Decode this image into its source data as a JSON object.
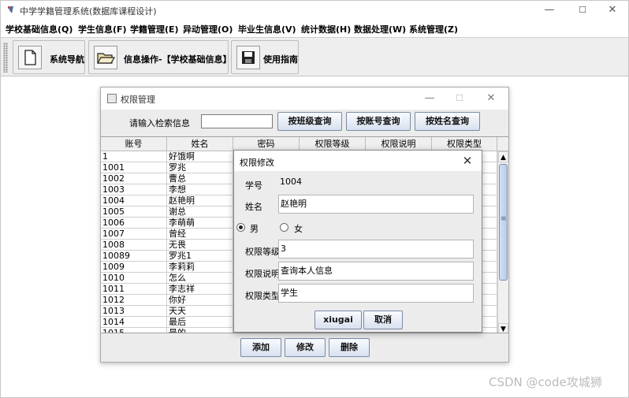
{
  "main_window": {
    "title": "中学学籍管理系统(数据库课程设计)",
    "controls": {
      "minimize": "—",
      "maximize": "☐",
      "close": "✕"
    }
  },
  "menubar": {
    "items": [
      {
        "label": "学校基础信息(Q)"
      },
      {
        "label": "学生信息(F)"
      },
      {
        "label": "学籍管理(E)"
      },
      {
        "label": "异动管理(O)"
      },
      {
        "label": "毕业生信息(V)"
      },
      {
        "label": "统计数据(H)"
      },
      {
        "label": "数据处理(W)"
      },
      {
        "label": "系统管理(Z)"
      }
    ]
  },
  "toolbar": {
    "buttons": [
      {
        "label": "系统导航",
        "icon": "document-icon"
      },
      {
        "label": "信息操作-【学校基础信息】",
        "icon": "folder-open-icon"
      },
      {
        "label": "使用指南",
        "icon": "floppy-disk-icon"
      }
    ]
  },
  "perm_window": {
    "title": "权限管理",
    "search_label": "请输入检索信息",
    "search_value": "",
    "buttons": {
      "by_class": "按班级查询",
      "by_account": "按账号查询",
      "by_name": "按姓名查询"
    },
    "columns": [
      "账号",
      "姓名",
      "密码",
      "权限等级",
      "权限说明",
      "权限类型"
    ],
    "rows": [
      [
        "1",
        "好饿啊",
        "",
        "",
        "",
        ""
      ],
      [
        "1001",
        "罗兆",
        "",
        "",
        "",
        ""
      ],
      [
        "1002",
        "曹总",
        "",
        "",
        "",
        ""
      ],
      [
        "1003",
        "李想",
        "",
        "",
        "",
        ""
      ],
      [
        "1004",
        "赵艳明",
        "",
        "",
        "",
        ""
      ],
      [
        "1005",
        "谢总",
        "",
        "",
        "",
        ""
      ],
      [
        "1006",
        "李萌萌",
        "",
        "",
        "",
        ""
      ],
      [
        "1007",
        "曾经",
        "",
        "",
        "",
        ""
      ],
      [
        "1008",
        "无畏",
        "",
        "",
        "",
        ""
      ],
      [
        "10089",
        "罗兆1",
        "",
        "",
        "",
        ""
      ],
      [
        "1009",
        "李莉莉",
        "",
        "",
        "",
        ""
      ],
      [
        "1010",
        "怎么",
        "",
        "",
        "",
        ""
      ],
      [
        "1011",
        "李志祥",
        "",
        "",
        "",
        ""
      ],
      [
        "1012",
        "你好",
        "",
        "",
        "",
        ""
      ],
      [
        "1013",
        "天天",
        "",
        "",
        "",
        ""
      ],
      [
        "1014",
        "最后",
        "",
        "",
        "",
        ""
      ],
      [
        "1015",
        "最的",
        "",
        "",
        "",
        ""
      ]
    ],
    "actions": {
      "add": "添加",
      "edit": "修改",
      "delete": "删除"
    }
  },
  "edit_dialog": {
    "title": "权限修改",
    "close": "✕",
    "student_id_label": "学号",
    "student_id_value": "1004",
    "name_label": "姓名",
    "name_value": "赵艳明",
    "gender_male": "男",
    "gender_female": "女",
    "gender_selected": "男",
    "level_label": "权限等级",
    "level_value": "3",
    "desc_label": "权限说明",
    "desc_value": "查询本人信息",
    "type_label": "权限类型",
    "type_value": "学生",
    "submit_label": "xiugai",
    "cancel_label": "取消"
  },
  "watermark": "CSDN @code攻城狮"
}
